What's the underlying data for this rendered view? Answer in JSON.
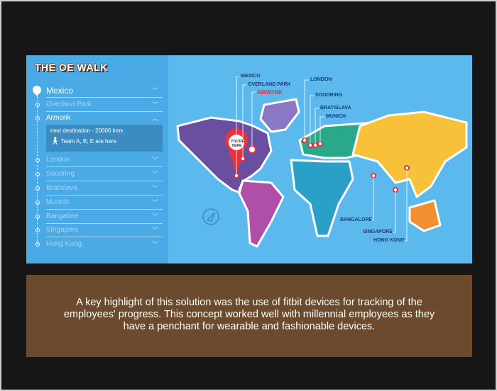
{
  "title": "THE OE WALK",
  "sidebar": {
    "items": [
      {
        "label": "Mexico",
        "state": "current"
      },
      {
        "label": "Overland Park"
      },
      {
        "label": "Armonk",
        "state": "expanded"
      },
      {
        "label": "London"
      },
      {
        "label": "Soodring"
      },
      {
        "label": "Bratislava"
      },
      {
        "label": "Munich"
      },
      {
        "label": "Bangalore"
      },
      {
        "label": "Singapore"
      },
      {
        "label": "Hong Kong"
      }
    ],
    "detail": {
      "distance": "next destination - 20000 kms",
      "teams": "Team A, B, E are here"
    }
  },
  "map": {
    "pin_text": "YOU'RE HERE",
    "labels": {
      "mexico": "MEXICO",
      "overland": "OVERLAND PARK",
      "armonk": "ARMONK",
      "london": "LONDON",
      "soodring": "SOODRING",
      "bratislava": "BRATISLAVA",
      "munich": "MUNICH",
      "bangalore": "BANGALORE",
      "singapore": "SINGAPORE",
      "hongkong": "HONG KONG"
    },
    "colors": {
      "north_america": "#6a4fa0",
      "greenland": "#8a78c4",
      "south_america": "#b04fa8",
      "europe": "#2aa88a",
      "africa": "#2a9fc8",
      "asia": "#f7c23a",
      "australia": "#f28f2e",
      "highlight": "#e8323c"
    }
  },
  "caption": "A key highlight of this solution was the use of fitbit devices for tracking of the employees' progress. This concept worked well with millennial employees as they have a penchant for wearable and fashionable devices."
}
